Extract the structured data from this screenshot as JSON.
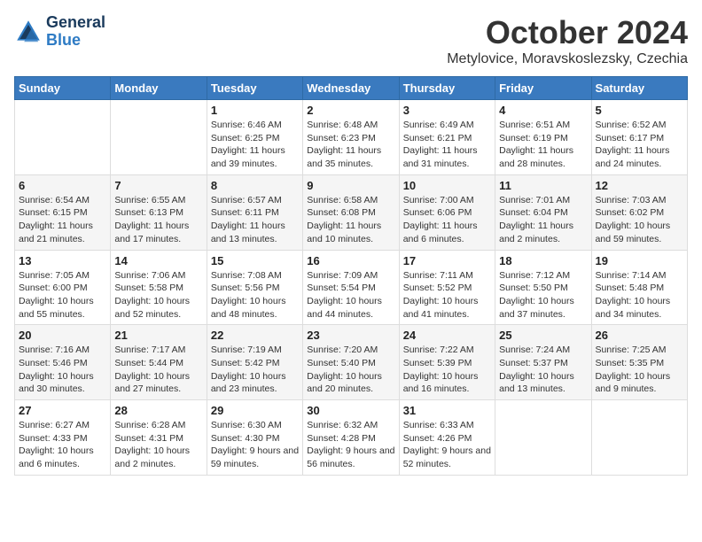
{
  "logo": {
    "line1": "General",
    "line2": "Blue"
  },
  "title": "October 2024",
  "location": "Metylovice, Moravskoslezsky, Czechia",
  "days_header": [
    "Sunday",
    "Monday",
    "Tuesday",
    "Wednesday",
    "Thursday",
    "Friday",
    "Saturday"
  ],
  "weeks": [
    [
      {
        "num": "",
        "info": ""
      },
      {
        "num": "",
        "info": ""
      },
      {
        "num": "1",
        "info": "Sunrise: 6:46 AM\nSunset: 6:25 PM\nDaylight: 11 hours and 39 minutes."
      },
      {
        "num": "2",
        "info": "Sunrise: 6:48 AM\nSunset: 6:23 PM\nDaylight: 11 hours and 35 minutes."
      },
      {
        "num": "3",
        "info": "Sunrise: 6:49 AM\nSunset: 6:21 PM\nDaylight: 11 hours and 31 minutes."
      },
      {
        "num": "4",
        "info": "Sunrise: 6:51 AM\nSunset: 6:19 PM\nDaylight: 11 hours and 28 minutes."
      },
      {
        "num": "5",
        "info": "Sunrise: 6:52 AM\nSunset: 6:17 PM\nDaylight: 11 hours and 24 minutes."
      }
    ],
    [
      {
        "num": "6",
        "info": "Sunrise: 6:54 AM\nSunset: 6:15 PM\nDaylight: 11 hours and 21 minutes."
      },
      {
        "num": "7",
        "info": "Sunrise: 6:55 AM\nSunset: 6:13 PM\nDaylight: 11 hours and 17 minutes."
      },
      {
        "num": "8",
        "info": "Sunrise: 6:57 AM\nSunset: 6:11 PM\nDaylight: 11 hours and 13 minutes."
      },
      {
        "num": "9",
        "info": "Sunrise: 6:58 AM\nSunset: 6:08 PM\nDaylight: 11 hours and 10 minutes."
      },
      {
        "num": "10",
        "info": "Sunrise: 7:00 AM\nSunset: 6:06 PM\nDaylight: 11 hours and 6 minutes."
      },
      {
        "num": "11",
        "info": "Sunrise: 7:01 AM\nSunset: 6:04 PM\nDaylight: 11 hours and 2 minutes."
      },
      {
        "num": "12",
        "info": "Sunrise: 7:03 AM\nSunset: 6:02 PM\nDaylight: 10 hours and 59 minutes."
      }
    ],
    [
      {
        "num": "13",
        "info": "Sunrise: 7:05 AM\nSunset: 6:00 PM\nDaylight: 10 hours and 55 minutes."
      },
      {
        "num": "14",
        "info": "Sunrise: 7:06 AM\nSunset: 5:58 PM\nDaylight: 10 hours and 52 minutes."
      },
      {
        "num": "15",
        "info": "Sunrise: 7:08 AM\nSunset: 5:56 PM\nDaylight: 10 hours and 48 minutes."
      },
      {
        "num": "16",
        "info": "Sunrise: 7:09 AM\nSunset: 5:54 PM\nDaylight: 10 hours and 44 minutes."
      },
      {
        "num": "17",
        "info": "Sunrise: 7:11 AM\nSunset: 5:52 PM\nDaylight: 10 hours and 41 minutes."
      },
      {
        "num": "18",
        "info": "Sunrise: 7:12 AM\nSunset: 5:50 PM\nDaylight: 10 hours and 37 minutes."
      },
      {
        "num": "19",
        "info": "Sunrise: 7:14 AM\nSunset: 5:48 PM\nDaylight: 10 hours and 34 minutes."
      }
    ],
    [
      {
        "num": "20",
        "info": "Sunrise: 7:16 AM\nSunset: 5:46 PM\nDaylight: 10 hours and 30 minutes."
      },
      {
        "num": "21",
        "info": "Sunrise: 7:17 AM\nSunset: 5:44 PM\nDaylight: 10 hours and 27 minutes."
      },
      {
        "num": "22",
        "info": "Sunrise: 7:19 AM\nSunset: 5:42 PM\nDaylight: 10 hours and 23 minutes."
      },
      {
        "num": "23",
        "info": "Sunrise: 7:20 AM\nSunset: 5:40 PM\nDaylight: 10 hours and 20 minutes."
      },
      {
        "num": "24",
        "info": "Sunrise: 7:22 AM\nSunset: 5:39 PM\nDaylight: 10 hours and 16 minutes."
      },
      {
        "num": "25",
        "info": "Sunrise: 7:24 AM\nSunset: 5:37 PM\nDaylight: 10 hours and 13 minutes."
      },
      {
        "num": "26",
        "info": "Sunrise: 7:25 AM\nSunset: 5:35 PM\nDaylight: 10 hours and 9 minutes."
      }
    ],
    [
      {
        "num": "27",
        "info": "Sunrise: 6:27 AM\nSunset: 4:33 PM\nDaylight: 10 hours and 6 minutes."
      },
      {
        "num": "28",
        "info": "Sunrise: 6:28 AM\nSunset: 4:31 PM\nDaylight: 10 hours and 2 minutes."
      },
      {
        "num": "29",
        "info": "Sunrise: 6:30 AM\nSunset: 4:30 PM\nDaylight: 9 hours and 59 minutes."
      },
      {
        "num": "30",
        "info": "Sunrise: 6:32 AM\nSunset: 4:28 PM\nDaylight: 9 hours and 56 minutes."
      },
      {
        "num": "31",
        "info": "Sunrise: 6:33 AM\nSunset: 4:26 PM\nDaylight: 9 hours and 52 minutes."
      },
      {
        "num": "",
        "info": ""
      },
      {
        "num": "",
        "info": ""
      }
    ]
  ]
}
